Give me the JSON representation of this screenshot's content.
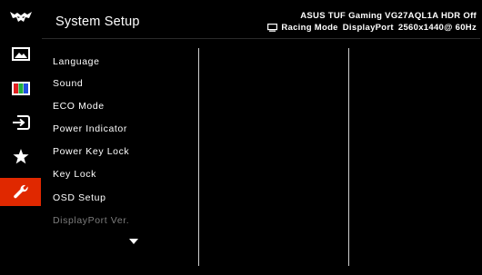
{
  "header": {
    "title": "System Setup",
    "model": "ASUS TUF Gaming  VG27AQL1A HDR Off",
    "mode": "Racing Mode",
    "input": "DisplayPort",
    "resolution": "2560x1440@ 60Hz"
  },
  "sidebar": {
    "items": [
      {
        "icon": "tuf-logo-icon",
        "active": false
      },
      {
        "icon": "image-icon",
        "active": false
      },
      {
        "icon": "color-bars-icon",
        "active": false
      },
      {
        "icon": "input-select-icon",
        "active": false
      },
      {
        "icon": "star-icon",
        "active": false
      },
      {
        "icon": "wrench-icon",
        "active": true
      }
    ],
    "accent": "#e02800"
  },
  "menu": {
    "items": [
      {
        "label": "Language",
        "enabled": true
      },
      {
        "label": "Sound",
        "enabled": true
      },
      {
        "label": "ECO Mode",
        "enabled": true
      },
      {
        "label": "Power Indicator",
        "enabled": true
      },
      {
        "label": "Power Key Lock",
        "enabled": true
      },
      {
        "label": "Key Lock",
        "enabled": true
      },
      {
        "label": "OSD Setup",
        "enabled": true
      },
      {
        "label": "DisplayPort Ver.",
        "enabled": false
      }
    ],
    "more_below": true
  }
}
